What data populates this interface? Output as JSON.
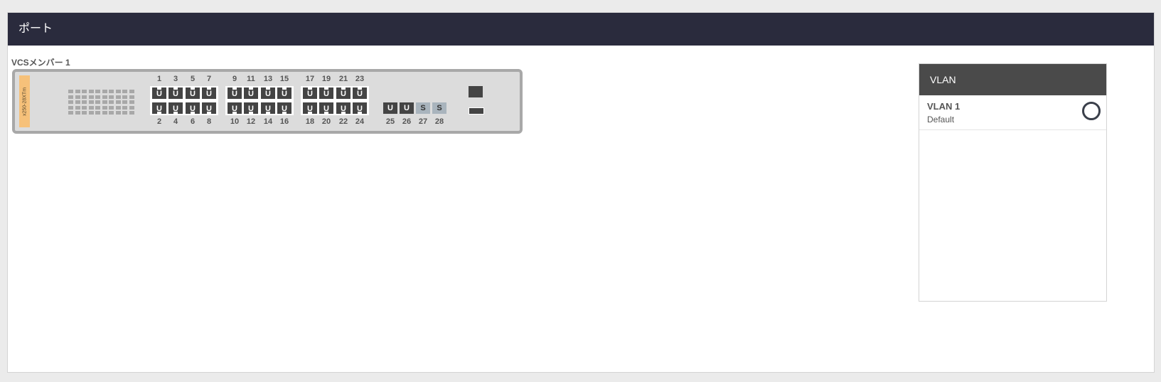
{
  "panel": {
    "title": "ポート"
  },
  "member": {
    "label": "VCSメンバー 1"
  },
  "switch": {
    "model": "x250-28XTm",
    "ports": [
      {
        "n": "1",
        "mode": "U"
      },
      {
        "n": "2",
        "mode": "U"
      },
      {
        "n": "3",
        "mode": "U"
      },
      {
        "n": "4",
        "mode": "U"
      },
      {
        "n": "5",
        "mode": "U"
      },
      {
        "n": "6",
        "mode": "U"
      },
      {
        "n": "7",
        "mode": "U"
      },
      {
        "n": "8",
        "mode": "U"
      },
      {
        "n": "9",
        "mode": "U"
      },
      {
        "n": "10",
        "mode": "U"
      },
      {
        "n": "11",
        "mode": "U"
      },
      {
        "n": "12",
        "mode": "U"
      },
      {
        "n": "13",
        "mode": "U"
      },
      {
        "n": "14",
        "mode": "U"
      },
      {
        "n": "15",
        "mode": "U"
      },
      {
        "n": "16",
        "mode": "U"
      },
      {
        "n": "17",
        "mode": "U"
      },
      {
        "n": "18",
        "mode": "U"
      },
      {
        "n": "19",
        "mode": "U"
      },
      {
        "n": "20",
        "mode": "U"
      },
      {
        "n": "21",
        "mode": "U"
      },
      {
        "n": "22",
        "mode": "U"
      },
      {
        "n": "23",
        "mode": "U"
      },
      {
        "n": "24",
        "mode": "U"
      },
      {
        "n": "25",
        "mode": "U"
      },
      {
        "n": "26",
        "mode": "U"
      },
      {
        "n": "27",
        "mode": "S"
      },
      {
        "n": "28",
        "mode": "S"
      }
    ]
  },
  "vlan": {
    "header": "VLAN",
    "items": [
      {
        "name": "VLAN 1",
        "desc": "Default"
      }
    ]
  },
  "colors": {
    "header_bg": "#2a2b3d",
    "port_untagged": "#444444",
    "port_stack": "#a9b4bd",
    "model_tag": "#f6c17a"
  }
}
